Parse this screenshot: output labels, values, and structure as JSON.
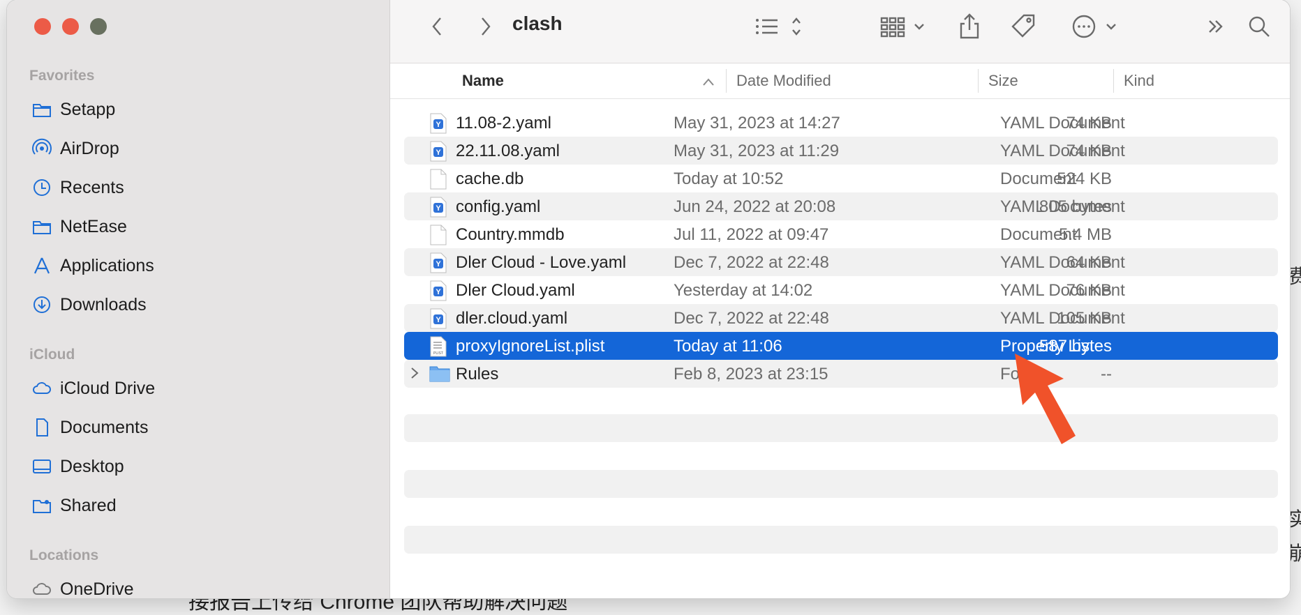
{
  "background_text": {
    "line1": "费",
    "line2": "实",
    "line3": "崩",
    "bottom": "接报告上传给 Chrome 团队帮助解决问题"
  },
  "window": {
    "title": "clash"
  },
  "sidebar": {
    "sections": [
      {
        "title": "Favorites",
        "items": [
          {
            "label": "Setapp",
            "icon": "folder-icon"
          },
          {
            "label": "AirDrop",
            "icon": "airdrop-icon"
          },
          {
            "label": "Recents",
            "icon": "clock-icon"
          },
          {
            "label": "NetEase",
            "icon": "folder-icon"
          },
          {
            "label": "Applications",
            "icon": "applications-icon"
          },
          {
            "label": "Downloads",
            "icon": "download-icon"
          }
        ]
      },
      {
        "title": "iCloud",
        "items": [
          {
            "label": "iCloud Drive",
            "icon": "cloud-icon"
          },
          {
            "label": "Documents",
            "icon": "document-icon"
          },
          {
            "label": "Desktop",
            "icon": "desktop-icon"
          },
          {
            "label": "Shared",
            "icon": "shared-folder-icon"
          }
        ]
      },
      {
        "title": "Locations",
        "items": [
          {
            "label": "OneDrive",
            "icon": "cloud-icon"
          }
        ]
      }
    ]
  },
  "columns": {
    "name": "Name",
    "date": "Date Modified",
    "size": "Size",
    "kind": "Kind"
  },
  "files": [
    {
      "name": "11.08-2.yaml",
      "date": "May 31, 2023 at 14:27",
      "size": "74 KB",
      "kind": "YAML Document",
      "icon": "yaml-file-icon"
    },
    {
      "name": "22.11.08.yaml",
      "date": "May 31, 2023 at 11:29",
      "size": "74 KB",
      "kind": "YAML Document",
      "icon": "yaml-file-icon"
    },
    {
      "name": "cache.db",
      "date": "Today at 10:52",
      "size": "524 KB",
      "kind": "Document",
      "icon": "blank-file-icon"
    },
    {
      "name": "config.yaml",
      "date": "Jun 24, 2022 at 20:08",
      "size": "805 bytes",
      "kind": "YAML Document",
      "icon": "yaml-file-icon"
    },
    {
      "name": "Country.mmdb",
      "date": "Jul 11, 2022 at 09:47",
      "size": "5.4 MB",
      "kind": "Document",
      "icon": "blank-file-icon"
    },
    {
      "name": "Dler Cloud - Love.yaml",
      "date": "Dec 7, 2022 at 22:48",
      "size": "64 KB",
      "kind": "YAML Document",
      "icon": "yaml-file-icon"
    },
    {
      "name": "Dler Cloud.yaml",
      "date": "Yesterday at 14:02",
      "size": "76 KB",
      "kind": "YAML Document",
      "icon": "yaml-file-icon"
    },
    {
      "name": "dler.cloud.yaml",
      "date": "Dec 7, 2022 at 22:48",
      "size": "105 KB",
      "kind": "YAML Document",
      "icon": "yaml-file-icon"
    },
    {
      "name": "proxyIgnoreList.plist",
      "date": "Today at 11:06",
      "size": "587 bytes",
      "kind": "Property List",
      "icon": "plist-file-icon",
      "selected": true
    },
    {
      "name": "Rules",
      "date": "Feb 8, 2023 at 23:15",
      "size": "--",
      "kind": "Folder",
      "icon": "folder-icon"
    }
  ],
  "plist_icon_text": "PLIST",
  "yaml_icon_text": "Y",
  "colors": {
    "selection": "#1466d8",
    "accent": "#1f6fd6",
    "annotation_arrow": "#f0522a"
  }
}
